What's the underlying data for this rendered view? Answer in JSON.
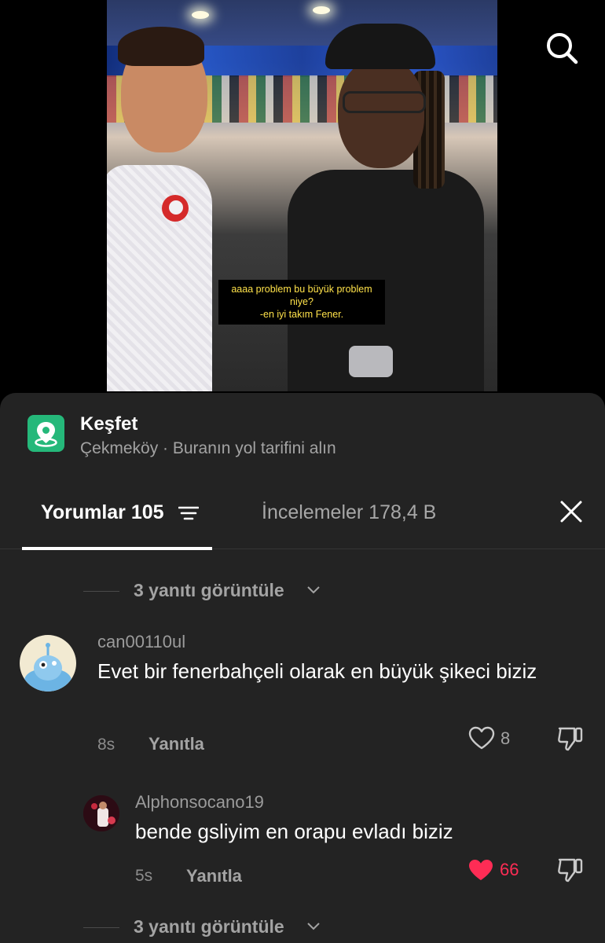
{
  "video": {
    "subtitle_lines": [
      "aaaa  problem bu büyük problem",
      "niye?",
      "-en iyi takım Fener."
    ]
  },
  "place": {
    "title": "Keşfet",
    "subtitle": "Çekmeköy · Buranın yol tarifini alın",
    "icon": "map-pin-icon",
    "color": "#25b87a"
  },
  "tabs": {
    "comments_label": "Yorumlar 105",
    "reviews_label": "İncelemeler 178,4 B"
  },
  "replies_toggle_1": {
    "label": "3 yanıtı görüntüle"
  },
  "comments": [
    {
      "username": "can00110ul",
      "text": "Evet bir fenerbahçeli olarak en büyük şikeci biziz",
      "time": "8s",
      "reply_label": "Yanıtla",
      "likes": "8",
      "liked": false
    }
  ],
  "reply": {
    "username": "Alphonsocano19",
    "text": "bende gsliyim en orapu evladı biziz",
    "time": "5s",
    "reply_label": "Yanıtla",
    "likes": "66",
    "liked": true,
    "like_color": "#fe2c55"
  },
  "replies_toggle_2": {
    "label": "3 yanıtı görüntüle"
  }
}
